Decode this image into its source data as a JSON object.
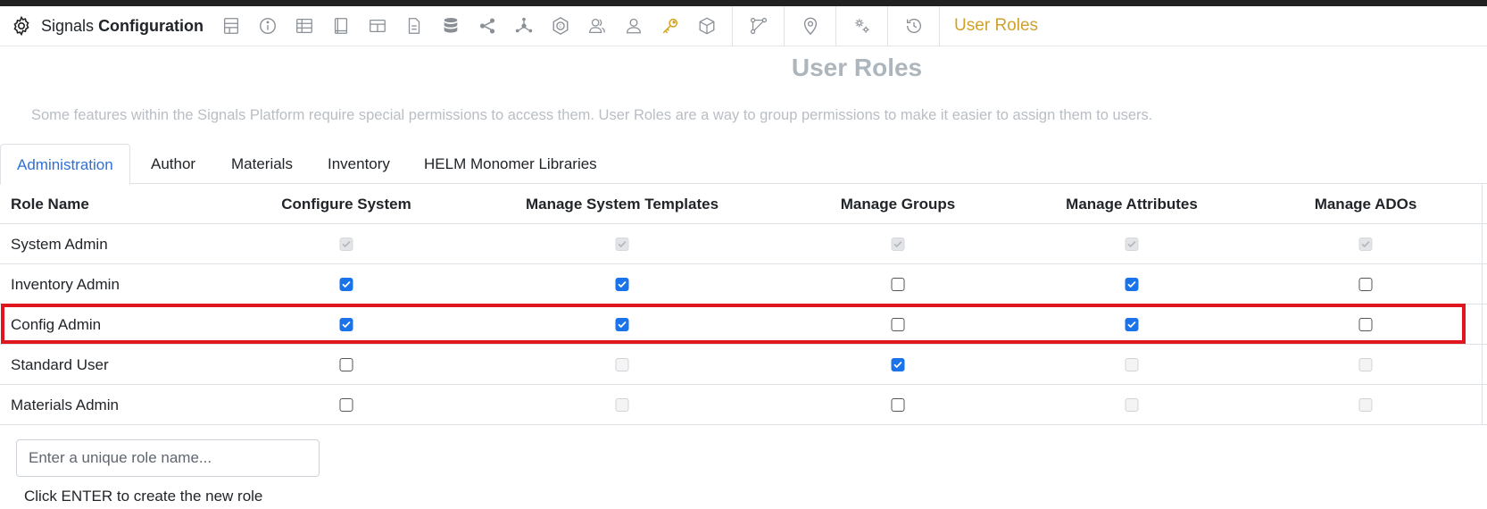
{
  "app": {
    "brand_light": "Signals",
    "brand_bold": "Configuration",
    "crumb": "User Roles"
  },
  "icons": [
    "layout-icon",
    "info-icon",
    "table-icon",
    "notebook-icon",
    "grid-table-icon",
    "document-icon",
    "database-icon",
    "share-icon",
    "network-icon",
    "chemistry-badge-icon",
    "users-icon",
    "user-icon",
    "key-icon",
    "cube-icon",
    "workflow-icon",
    "location-pin-icon",
    "settings-gears-icon",
    "history-icon"
  ],
  "colors": {
    "active_icon": "#d39e1a",
    "tab_active": "#2f6fd8",
    "checkbox": "#1a73e8",
    "highlight": "#e0161e"
  },
  "page": {
    "title": "User Roles",
    "description": "Some features within the Signals Platform require special permissions to access them. User Roles are a way to group permissions to make it easier to assign them to users."
  },
  "tabs": [
    {
      "label": "Administration",
      "active": true
    },
    {
      "label": "Author"
    },
    {
      "label": "Materials"
    },
    {
      "label": "Inventory"
    },
    {
      "label": "HELM Monomer Libraries"
    }
  ],
  "table": {
    "headers": [
      "Role Name",
      "Configure System",
      "Manage System Templates",
      "Manage Groups",
      "Manage Attributes",
      "Manage ADOs"
    ],
    "rows": [
      {
        "name": "System Admin",
        "cells": [
          {
            "checked": true,
            "disabled": true
          },
          {
            "checked": true,
            "disabled": true
          },
          {
            "checked": true,
            "disabled": true
          },
          {
            "checked": true,
            "disabled": true
          },
          {
            "checked": true,
            "disabled": true
          }
        ]
      },
      {
        "name": "Inventory Admin",
        "cells": [
          {
            "checked": true,
            "disabled": false
          },
          {
            "checked": true,
            "disabled": false
          },
          {
            "checked": false,
            "disabled": false
          },
          {
            "checked": true,
            "disabled": false
          },
          {
            "checked": false,
            "disabled": false
          }
        ]
      },
      {
        "name": "Config Admin",
        "highlighted": true,
        "cells": [
          {
            "checked": true,
            "disabled": false
          },
          {
            "checked": true,
            "disabled": false
          },
          {
            "checked": false,
            "disabled": false
          },
          {
            "checked": true,
            "disabled": false
          },
          {
            "checked": false,
            "disabled": false
          }
        ]
      },
      {
        "name": "Standard User",
        "cells": [
          {
            "checked": false,
            "disabled": false
          },
          {
            "checked": false,
            "disabled": true
          },
          {
            "checked": true,
            "disabled": false
          },
          {
            "checked": false,
            "disabled": true
          },
          {
            "checked": false,
            "disabled": true
          }
        ]
      },
      {
        "name": "Materials Admin",
        "cells": [
          {
            "checked": false,
            "disabled": false
          },
          {
            "checked": false,
            "disabled": true
          },
          {
            "checked": false,
            "disabled": false
          },
          {
            "checked": false,
            "disabled": true
          },
          {
            "checked": false,
            "disabled": true
          }
        ]
      }
    ]
  },
  "new_role": {
    "placeholder": "Enter a unique role name...",
    "value": "",
    "hint": "Click ENTER to create the new role"
  }
}
